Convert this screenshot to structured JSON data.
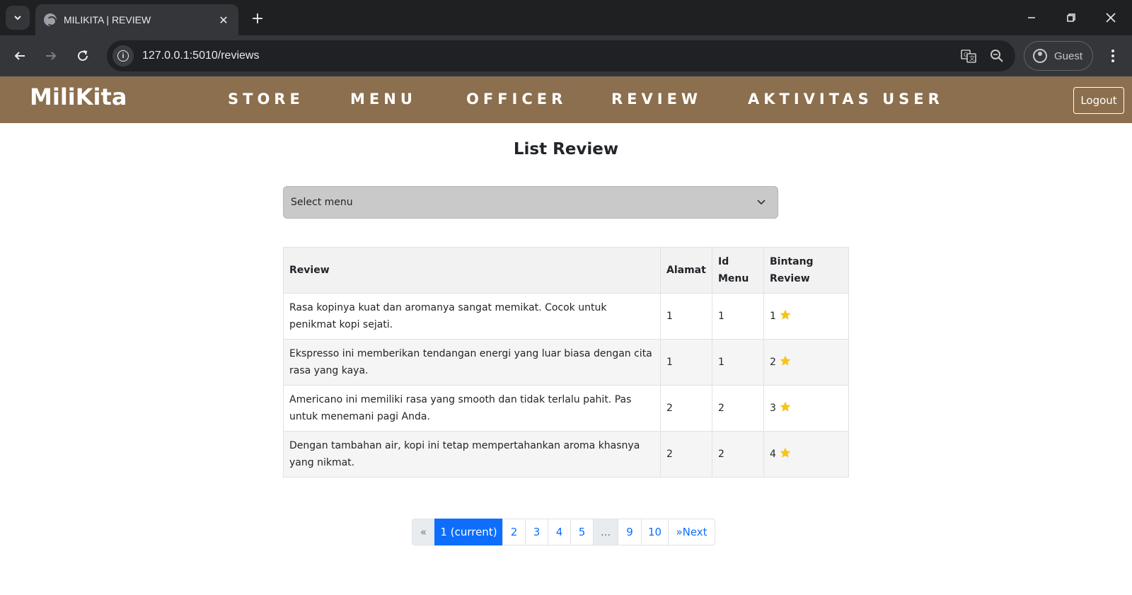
{
  "browser": {
    "tab_title": "MILIKITA | REVIEW",
    "url": "127.0.0.1:5010/reviews",
    "profile_label": "Guest"
  },
  "navbar": {
    "brand": "MiliKita",
    "links": [
      "STORE",
      "MENU",
      "OFFICER",
      "REVIEW",
      "AKTIVITAS USER"
    ],
    "logout_label": "Logout",
    "background_color": "#8b6f4e"
  },
  "main": {
    "title": "List Review",
    "select": {
      "selected": "Select menu"
    },
    "table": {
      "headers": {
        "review": "Review",
        "alamat": "Alamat",
        "id_menu": "Id Menu",
        "bintang": "Bintang Review"
      },
      "rows": [
        {
          "review": "Rasa kopinya kuat dan aromanya sangat memikat. Cocok untuk penikmat kopi sejati.",
          "alamat": "1",
          "id_menu": "1",
          "bintang": "1"
        },
        {
          "review": "Ekspresso ini memberikan tendangan energi yang luar biasa dengan cita rasa yang kaya.",
          "alamat": "1",
          "id_menu": "1",
          "bintang": "2"
        },
        {
          "review": "Americano ini memiliki rasa yang smooth dan tidak terlalu pahit. Pas untuk menemani pagi Anda.",
          "alamat": "2",
          "id_menu": "2",
          "bintang": "3"
        },
        {
          "review": "Dengan tambahan air, kopi ini tetap mempertahankan aroma khasnya yang nikmat.",
          "alamat": "2",
          "id_menu": "2",
          "bintang": "4"
        }
      ],
      "star_color": "#f5c518"
    },
    "pagination": {
      "prev": "«",
      "current": "1 (current)",
      "pages": [
        "2",
        "3",
        "4",
        "5"
      ],
      "ellipsis": "...",
      "tail_pages": [
        "9",
        "10"
      ],
      "next": "»Next",
      "active_color": "#0d6efd"
    }
  }
}
